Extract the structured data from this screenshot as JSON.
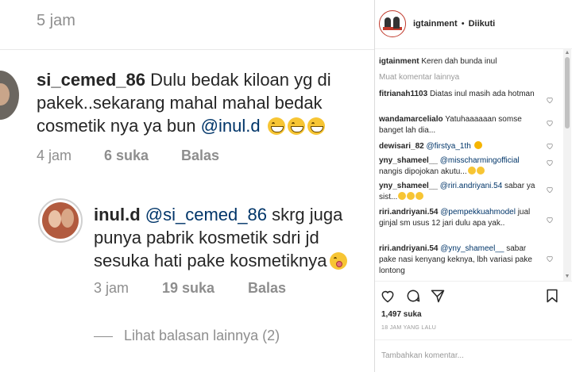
{
  "left": {
    "top_timestamp": "5 jam",
    "comment1": {
      "username": "si_cemed_86",
      "text": "Dulu bedak kiloan yg di pakek..sekarang mahal mahal bedak cosmetik nya ya bun",
      "mention": "@inul.d",
      "time": "4 jam",
      "likes": "6 suka",
      "reply": "Balas"
    },
    "comment2": {
      "username": "inul.d",
      "mention": "@si_cemed_86",
      "text": "skrg juga punya pabrik kosmetik sdri jd sesuka hati pake kosmetiknya",
      "time": "3 jam",
      "likes": "19 suka",
      "reply": "Balas"
    },
    "more_replies": "Lihat balasan lainnya (2)"
  },
  "right": {
    "header": {
      "username": "igtainment",
      "separator": "•",
      "follow_status": "Diikuti"
    },
    "caption": {
      "username": "igtainment",
      "text": "Keren dah bunda inul"
    },
    "load_more": "Muat komentar lainnya",
    "comments": [
      {
        "username": "fitrianah1103",
        "mention": "",
        "text": "Diatas inul masih ada hotman"
      },
      {
        "username": "wandamarcelialo",
        "mention": "",
        "text": "Yatuhaaaaaan somse banget lah dia..."
      },
      {
        "username": "dewisari_82",
        "mention": "@firstya_1th",
        "text": ""
      },
      {
        "username": "yny_shameel__",
        "mention": "@misscharmingofficial",
        "text": "nangis dipojokan akutu..."
      },
      {
        "username": "yny_shameel__",
        "mention": "@riri.andriyani.54",
        "text": "sabar ya sist..."
      },
      {
        "username": "riri.andriyani.54",
        "mention": "@pempekkuahmodel",
        "text": "jual ginjal sm usus 12 jari dulu apa yak.."
      },
      {
        "username": "riri.andriyani.54",
        "mention": "@yny_shameel__",
        "text": "sabar pake nasi kenyang keknya, lbh variasi pake lontong"
      }
    ],
    "likes": "1,497 suka",
    "time": "18 JAM YANG LALU",
    "add_comment_placeholder": "Tambahkan komentar..."
  }
}
